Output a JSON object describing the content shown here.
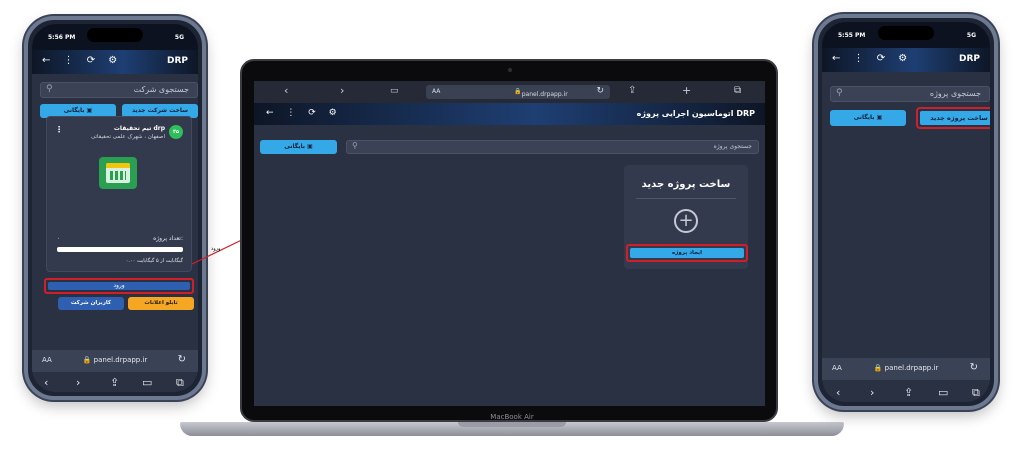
{
  "left_phone": {
    "time": "5:56 PM",
    "signal": "5G",
    "brand": "DRP",
    "nav_icons": "← ⋮ ⟳ ⚙",
    "search_placeholder": "جستجوی شرکت",
    "new_company_label": "ساخت شرکت جدید",
    "archive_label": "بایگانی",
    "card": {
      "badge": "۴۵",
      "company_name": "تیم تحقیقات drp",
      "location": "اصفهان ، شهرک علمی تحقیقاتی",
      "project_count_label": "تعداد پروژه:",
      "project_count_value": "۰",
      "storage_text": "۰.۰۰ گیگابایت از ۵ گیگابایت",
      "storage_used_fraction": 0
    },
    "enter_label": "ورود",
    "info_board_label": "تابلو اعلانات",
    "company_users_label": "کاربران شرکت",
    "url": "panel.drpapp.ir",
    "aa": "AA"
  },
  "arrow_label": "ورود",
  "laptop": {
    "url": "panel.drpapp.ir",
    "aa": "AA",
    "app_title": "اتوماسیون اجرایی پروژه DRP",
    "nav_icons": "← ⋮ ⟳ ⚙",
    "archive_label": "بایگانی",
    "search_placeholder": "جستجوی پروژه",
    "new_project_title": "ساخت پروژه جدید",
    "create_project_label": "ایجاد پروژه",
    "model_label": "MacBook Air"
  },
  "right_phone": {
    "time": "5:55 PM",
    "signal": "5G",
    "brand": "DRP",
    "nav_icons": "← ⋮ ⟳ ⚙",
    "search_placeholder": "جستجوی پروژه",
    "new_project_label": "ساخت پروژه جدید",
    "archive_label": "بایگانی",
    "url": "panel.drpapp.ir",
    "aa": "AA"
  },
  "colors": {
    "accent": "#35a9e8",
    "highlight": "#d11f2a",
    "background": "#2a3143",
    "enter_button": "#2f5fb0",
    "info_button": "#f5a623",
    "users_button": "#2f5fb0"
  }
}
